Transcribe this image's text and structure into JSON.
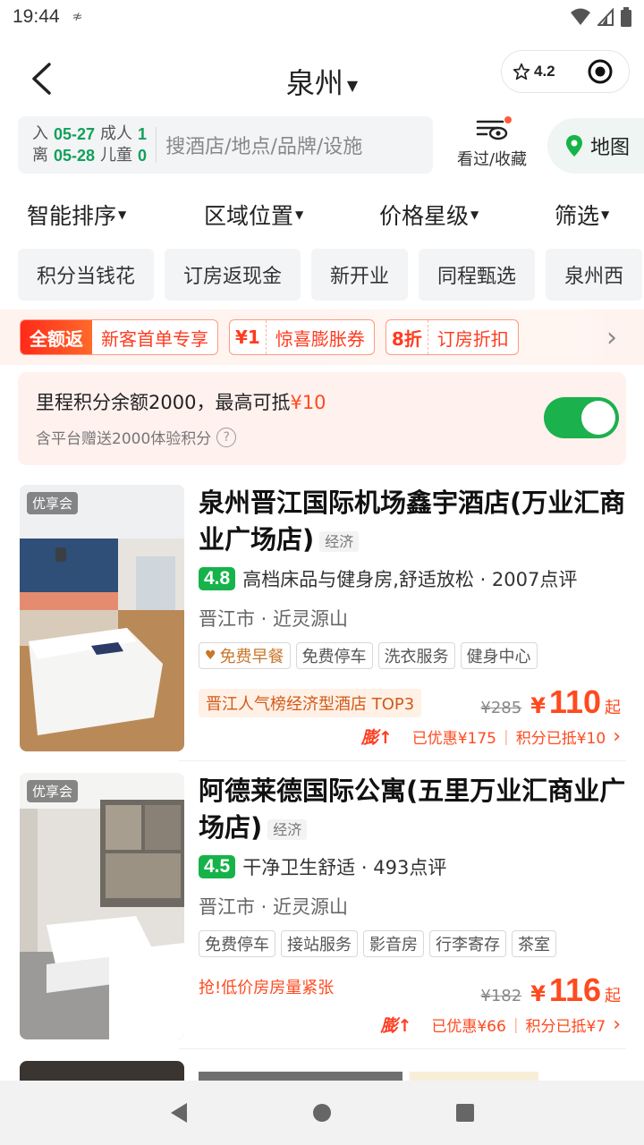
{
  "status_bar": {
    "time": "19:44"
  },
  "header": {
    "city": "泉州",
    "rating": "4.2"
  },
  "search": {
    "checkin_label": "入",
    "checkin_date": "05-27",
    "checkout_label": "离",
    "checkout_date": "05-28",
    "adults_label": "成人",
    "adults": "1",
    "children_label": "儿童",
    "children": "0",
    "placeholder": "搜酒店/地点/品牌/设施",
    "fav_label": "看过/收藏",
    "map_label": "地图"
  },
  "sort_tabs": [
    "智能排序",
    "区域位置",
    "价格星级",
    "筛选"
  ],
  "chips": [
    "积分当钱花",
    "订房返现金",
    "新开业",
    "同程甄选",
    "泉州西"
  ],
  "promos": [
    {
      "left": "全额返",
      "right": "新客首单专享",
      "solid": true
    },
    {
      "left": "¥1",
      "right": "惊喜膨胀券",
      "solid": false
    },
    {
      "left": "8折",
      "right": "订房折扣",
      "solid": false
    }
  ],
  "points": {
    "text": "里程积分余额2000，最高可抵",
    "amount": "¥10",
    "sub": "含平台赠送2000体验积分",
    "toggle_on": true
  },
  "hotels": [
    {
      "badge": "优享会",
      "name": "泉州晋江国际机场鑫宇酒店(万业汇商业广场店)",
      "grade": "经济",
      "score": "4.8",
      "highlight": "高档床品与健身房,舒适放松",
      "reviews": "· 2007点评",
      "location": "晋江市 · 近灵源山",
      "tags": [
        "免费早餐",
        "免费停车",
        "洗衣服务",
        "健身中心"
      ],
      "rank": "晋江人气榜经济型酒店 TOP3",
      "old_price": "¥285",
      "yen": "¥",
      "price": "110",
      "price_suffix": "起",
      "boost": "膨↑",
      "discount1": "已优惠¥175",
      "discount2": "积分已抵¥10",
      "chevron": "›"
    },
    {
      "badge": "优享会",
      "name": "阿德莱德国际公寓(五里万业汇商业广场店)",
      "grade": "经济",
      "score": "4.5",
      "highlight": "干净卫生舒适",
      "reviews": "· 493点评",
      "location": "晋江市 · 近灵源山",
      "tags": [
        "免费停车",
        "接站服务",
        "影音房",
        "行李寄存",
        "茶室"
      ],
      "urgent": "抢!低价房房量紧张",
      "old_price": "¥182",
      "yen": "¥",
      "price": "116",
      "price_suffix": "起",
      "boost": "膨↑",
      "discount1": "已优惠¥66",
      "discount2": "积分已抵¥7",
      "chevron": "›"
    }
  ],
  "colors": {
    "accent_green": "#16b34a",
    "price_red": "#ff4a1f"
  }
}
